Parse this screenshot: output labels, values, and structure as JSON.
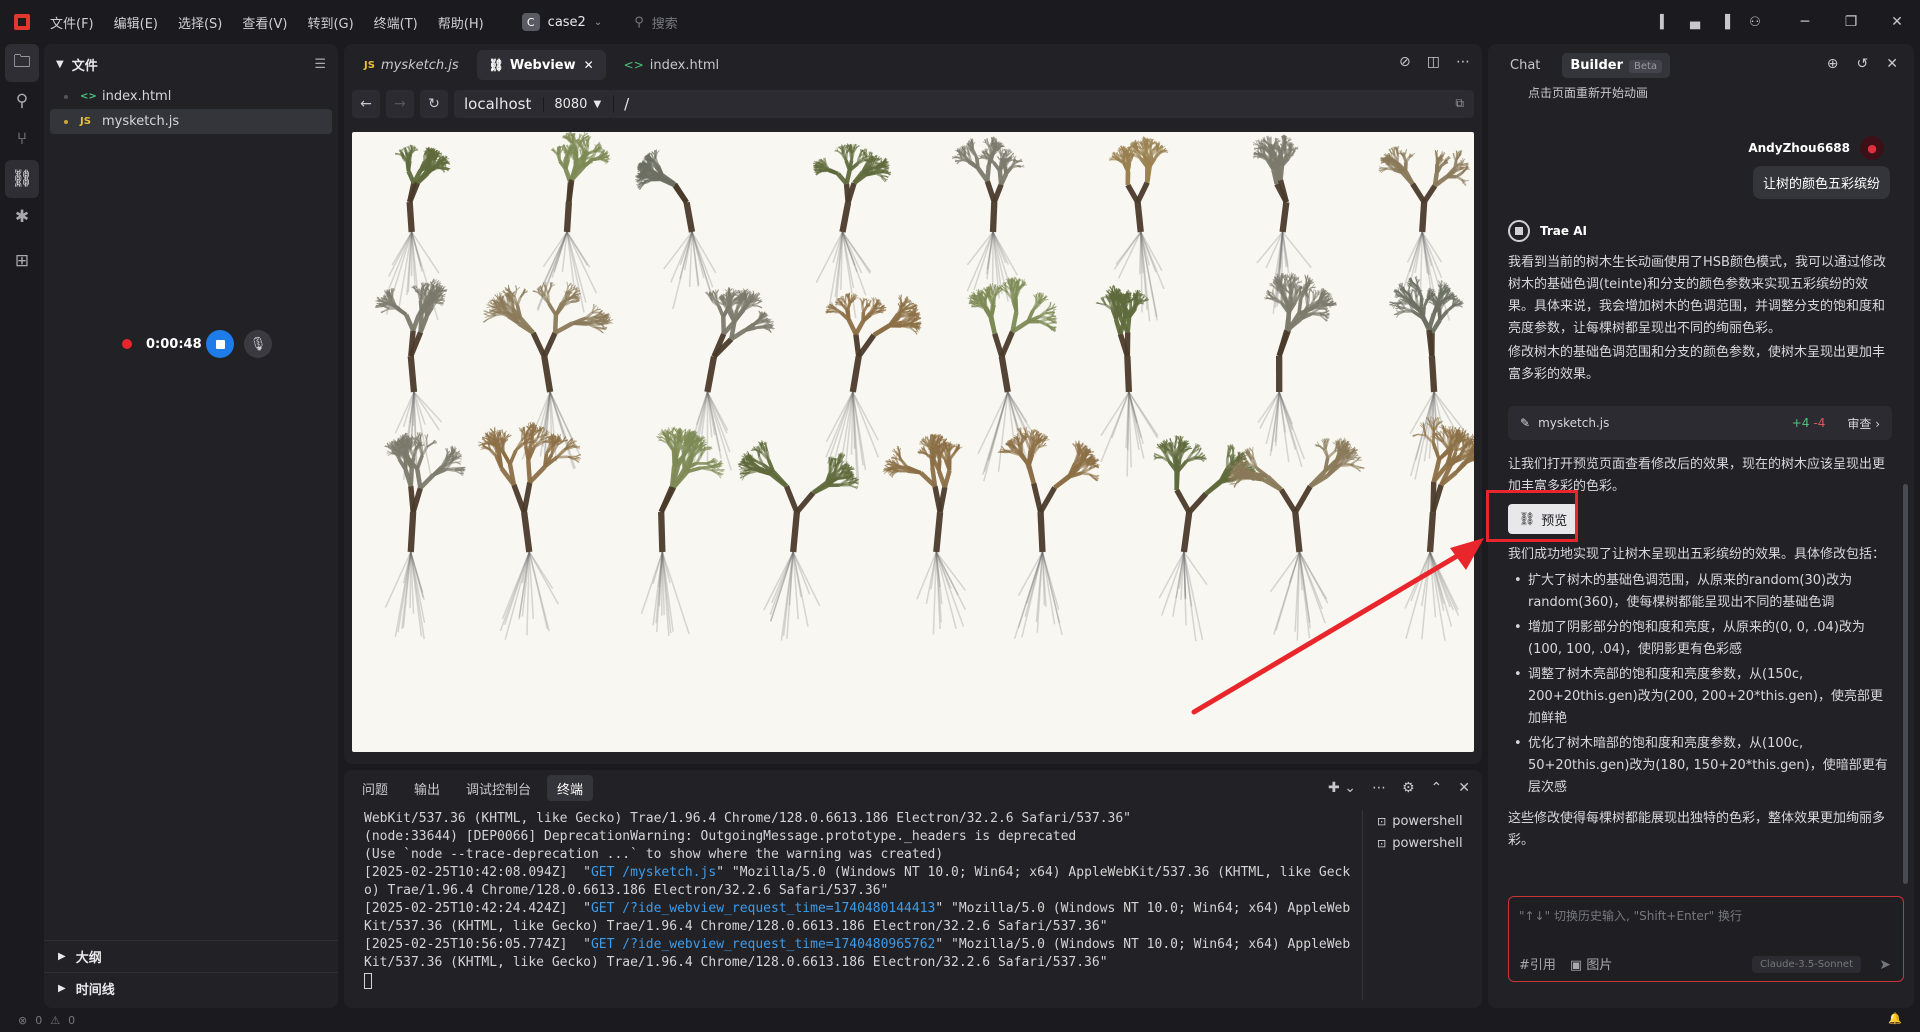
{
  "titlebar": {
    "menu": [
      "文件(F)",
      "编辑(E)",
      "选择(S)",
      "查看(V)",
      "转到(G)",
      "终端(T)",
      "帮助(H)"
    ],
    "project_badge": "C",
    "project_name": "case2",
    "search_placeholder": "搜索"
  },
  "explorer": {
    "title": "文件",
    "files": [
      {
        "name": "index.html",
        "type": "html"
      },
      {
        "name": "mysketch.js",
        "type": "js"
      }
    ],
    "outline_label": "大纲",
    "timeline_label": "时间线"
  },
  "recorder": {
    "time": "0:00:48"
  },
  "editor": {
    "tabs": [
      {
        "label": "mysketch.js",
        "kind": "JS"
      },
      {
        "label": "Webview",
        "kind": "link"
      },
      {
        "label": "index.html",
        "kind": "html"
      }
    ],
    "address": {
      "host": "localhost",
      "port": "8080",
      "path": "/"
    }
  },
  "panel": {
    "tabs": [
      "问题",
      "输出",
      "调试控制台",
      "终端"
    ],
    "terminal_lines": [
      {
        "pre": "WebKit/537.36 (KHTML, like Gecko) Trae/1.96.4 Chrome/128.0.6613.186 Electron/32.2.6 Safari/537.36\"",
        "url": "",
        "post": ""
      },
      {
        "pre": "(node:33644) [DEP0066] DeprecationWarning: OutgoingMessage.prototype._headers is deprecated",
        "url": "",
        "post": ""
      },
      {
        "pre": "(Use `node --trace-deprecation ...` to show where the warning was created)",
        "url": "",
        "post": ""
      },
      {
        "pre": "[2025-02-25T10:42:08.094Z]  \"",
        "url": "GET /mysketch.js",
        "post": "\" \"Mozilla/5.0 (Windows NT 10.0; Win64; x64) AppleWebKit/537.36 (KHTML, like Gecko) Trae/1.96.4 Chrome/128.0.6613.186 Electron/32.2.6 Safari/537.36\""
      },
      {
        "pre": "[2025-02-25T10:42:24.424Z]  \"",
        "url": "GET /?ide_webview_request_time=1740480144413",
        "post": "\" \"Mozilla/5.0 (Windows NT 10.0; Win64; x64) AppleWebKit/537.36 (KHTML, like Gecko) Trae/1.96.4 Chrome/128.0.6613.186 Electron/32.2.6 Safari/537.36\""
      },
      {
        "pre": "[2025-02-25T10:56:05.774Z]  \"",
        "url": "GET /?ide_webview_request_time=1740480965762",
        "post": "\" \"Mozilla/5.0 (Windows NT 10.0; Win64; x64) AppleWebKit/537.36 (KHTML, like Gecko) Trae/1.96.4 Chrome/128.0.6613.186 Electron/32.2.6 Safari/537.36\""
      }
    ],
    "shells": [
      "powershell",
      "powershell"
    ]
  },
  "chat": {
    "tabs": {
      "chat": "Chat",
      "builder": "Builder",
      "beta": "Beta"
    },
    "clipped_top": "点击页面重新开始动画",
    "user_name": "AndyZhou6688",
    "user_message": "让树的颜色五彩缤纷",
    "ai_name": "Trae AI",
    "p1": "我看到当前的树木生长动画使用了HSB颜色模式，我可以通过修改树木的基础色调(teinte)和分支的颜色参数来实现五彩缤纷的效果。具体来说，我会增加树木的色调范围，并调整分支的饱和度和亮度参数，让每棵树都呈现出不同的绚丽色彩。",
    "p2": "修改树木的基础色调范围和分支的颜色参数，使树木呈现出更加丰富多彩的效果。",
    "file_card": {
      "name": "mysketch.js",
      "plus": "+4",
      "minus": "-4",
      "review": "审查 ›"
    },
    "p3": "让我们打开预览页面查看修改后的效果，现在的树木应该呈现出更加丰富多彩的色彩。",
    "preview_button": "预览",
    "p4": "我们成功地实现了让树木呈现出五彩缤纷的效果。具体修改包括：",
    "bullets": [
      "扩大了树木的基础色调范围，从原来的random(30)改为random(360)，使每棵树都能呈现出不同的基础色调",
      "增加了阴影部分的饱和度和亮度，从原来的(0, 0, .04)改为(100, 100, .04)，使阴影更有色彩感",
      "调整了树木亮部的饱和度和亮度参数，从(150c, 200+20this.gen)改为(200, 200+20*this.gen)，使亮部更加鲜艳",
      "优化了树木暗部的饱和度和亮度参数，从(100c, 50+20this.gen)改为(180, 150+20*this.gen)，使暗部更有层次感"
    ],
    "p5": "这些修改使得每棵树都能展现出独特的色彩，整体效果更加绚丽多彩。",
    "input_placeholder": "\"↑↓\" 切换历史输入, \"Shift+Enter\" 换行",
    "tool_ref": "#引用",
    "tool_image": "图片",
    "model": "Claude-3.5-Sonnet"
  },
  "statusbar": {
    "errors": "0",
    "warnings": "0"
  },
  "colors": {
    "accent": "#1e7ce8",
    "annotation": "#e8262b",
    "canvas": "#f8f7f1"
  }
}
